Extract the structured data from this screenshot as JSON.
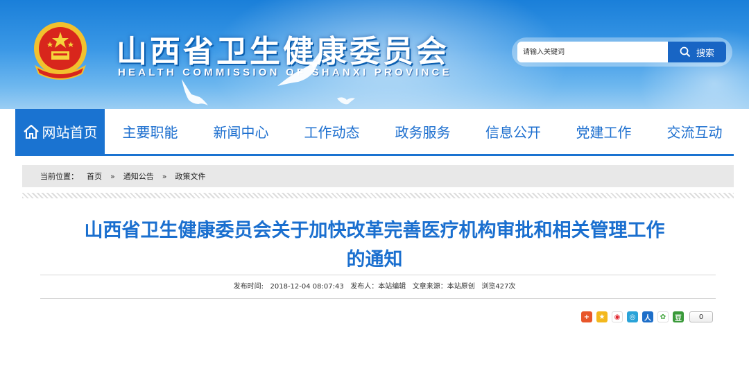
{
  "header": {
    "title_cn": "山西省卫生健康委员会",
    "title_en": "HEALTH COMMISSION OF SHANXI PROVINCE",
    "emblem_icon": "national-emblem-icon"
  },
  "search": {
    "placeholder": "请输入关键词",
    "button_label": "搜索",
    "button_icon": "search-icon"
  },
  "nav": {
    "home_label": "网站首页",
    "home_icon": "home-icon",
    "items": [
      {
        "label": "主要职能"
      },
      {
        "label": "新闻中心"
      },
      {
        "label": "工作动态"
      },
      {
        "label": "政务服务"
      },
      {
        "label": "信息公开"
      },
      {
        "label": "党建工作"
      },
      {
        "label": "交流互动"
      }
    ]
  },
  "breadcrumb": {
    "prefix": "当前位置：",
    "items": [
      "首页",
      "通知公告",
      "政策文件"
    ],
    "separator": "»"
  },
  "article": {
    "title_line1": "山西省卫生健康委员会关于加快改革完善医疗机构审批和相关管理工作",
    "title_line2": "的通知",
    "meta": "发布时间:   2018-12-04 08:07:43   发布人：本站编辑   文章来源：本站原创   浏览427次"
  },
  "share": {
    "icons": [
      "share-more-icon",
      "qzone-icon",
      "weibo-icon",
      "tencent-weibo-icon",
      "renren-icon",
      "kaixin-icon",
      "douban-icon"
    ],
    "count": "0"
  },
  "colors": {
    "brand_blue": "#1a73d1",
    "title_blue": "#1a6fcf",
    "search_button": "#1865c4"
  }
}
